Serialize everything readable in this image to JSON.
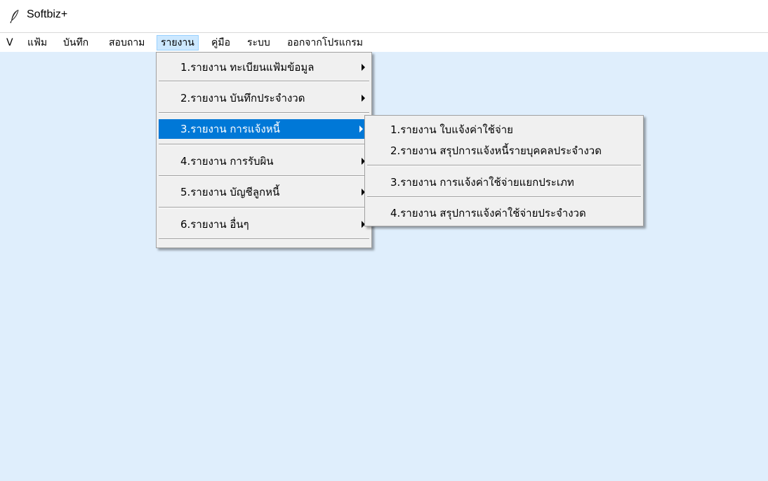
{
  "window": {
    "title": "Softbiz+",
    "icon": "feather-icon"
  },
  "menubar": {
    "items": [
      {
        "label": "V"
      },
      {
        "label": "แฟ้ม"
      },
      {
        "label": "บันทึก"
      },
      {
        "label": "สอบถาม"
      },
      {
        "label": "รายงาน",
        "active": true
      },
      {
        "label": "คู่มือ"
      },
      {
        "label": "ระบบ"
      },
      {
        "label": "ออกจากโปรแกรม"
      }
    ]
  },
  "report_menu": {
    "items": [
      {
        "label": "1.รายงาน ทะเบียนแฟ้มข้อมูล",
        "has_submenu": true
      },
      {
        "label": "2.รายงาน บันทึกประจำงวด",
        "has_submenu": true
      },
      {
        "label": "3.รายงาน การแจ้งหนี้",
        "has_submenu": true,
        "highlighted": true
      },
      {
        "label": "4.รายงาน การรับผิน",
        "has_submenu": true
      },
      {
        "label": "5.รายงาน บัญชีลูกหนี้",
        "has_submenu": true
      },
      {
        "label": "6.รายงาน อื่นๆ",
        "has_submenu": true
      }
    ]
  },
  "billing_submenu": {
    "items": [
      {
        "label": "1.รายงาน ใบแจ้งค่าใช้จ่าย"
      },
      {
        "label": "2.รายงาน สรุปการแจ้งหนี้รายบุคคลประจำงวด"
      },
      {
        "label": "3.รายงาน การแจ้งค่าใช้จ่ายแยกประเภท"
      },
      {
        "label": "4.รายงาน สรุปการแจ้งค่าใช้จ่ายประจำงวด"
      }
    ]
  },
  "colors": {
    "workspace": "#dfeefc",
    "highlight": "#0078d7",
    "menu_bg": "#f0f0f0",
    "active_menubar": "#cce8ff"
  }
}
